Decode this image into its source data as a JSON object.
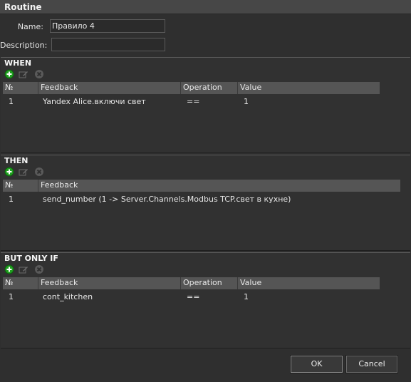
{
  "window": {
    "title": "Routine"
  },
  "form": {
    "name_label": "Name:",
    "name_value": "Правило 4",
    "description_label": "Description:",
    "description_value": ""
  },
  "icons": {
    "add": "add-icon",
    "edit": "edit-icon",
    "delete": "delete-icon",
    "colors": {
      "add": "#1f9e1f",
      "disabled": "#6b6b6b"
    }
  },
  "when": {
    "title": "WHEN",
    "columns": [
      "№",
      "Feedback",
      "Operation",
      "Value"
    ],
    "rows": [
      {
        "num": "1",
        "feedback": "Yandex Alice.включи свет",
        "operation": "==",
        "value": "1"
      }
    ]
  },
  "then": {
    "title": "THEN",
    "columns": [
      "№",
      "Feedback"
    ],
    "rows": [
      {
        "num": "1",
        "feedback": "send_number (1 -> Server.Channels.Modbus TCP.свет в кухне)"
      }
    ]
  },
  "only_if": {
    "title": "BUT ONLY IF",
    "columns": [
      "№",
      "Feedback",
      "Operation",
      "Value"
    ],
    "rows": [
      {
        "num": "1",
        "feedback": "cont_kitchen",
        "operation": "==",
        "value": "1"
      }
    ]
  },
  "buttons": {
    "ok": "OK",
    "cancel": "Cancel"
  }
}
